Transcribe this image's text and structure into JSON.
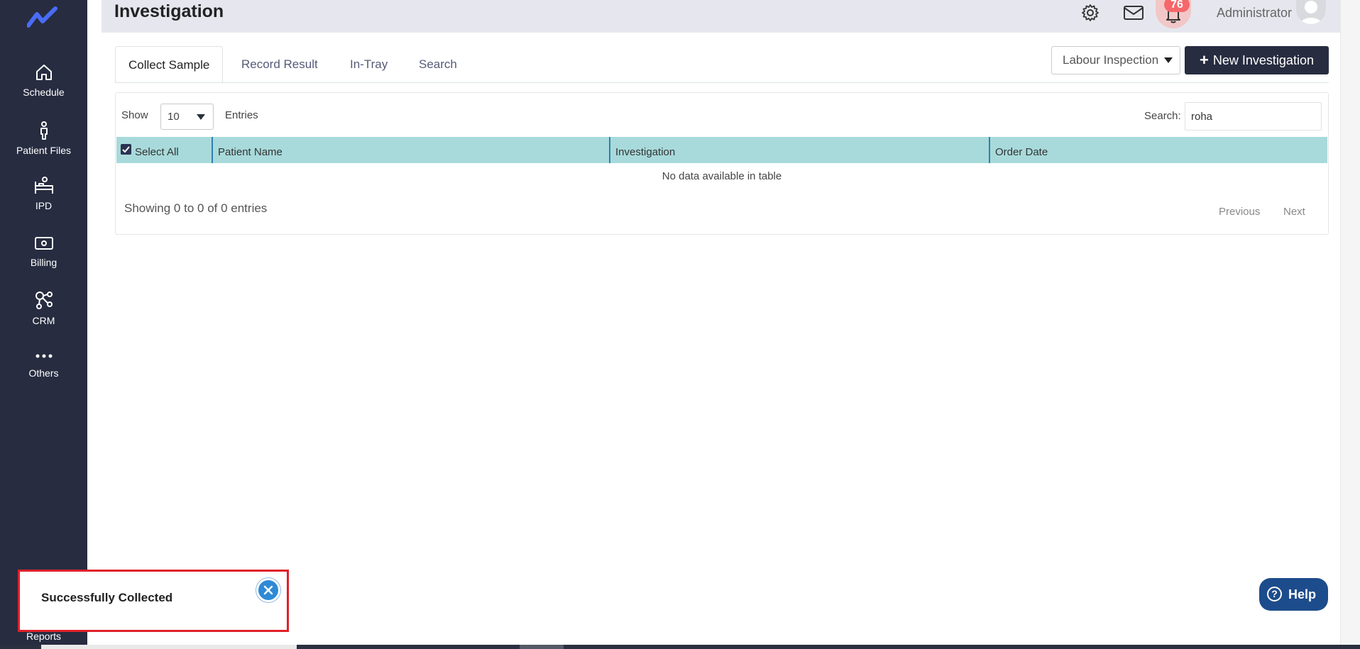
{
  "app": {
    "page_title": "Investigation",
    "admin_name": "Administrator",
    "notification_count": "76"
  },
  "sidebar": {
    "items": [
      {
        "label": "Schedule",
        "icon": "home-icon"
      },
      {
        "label": "Patient Files",
        "icon": "person-icon"
      },
      {
        "label": "IPD",
        "icon": "bed-icon"
      },
      {
        "label": "Billing",
        "icon": "money-icon"
      },
      {
        "label": "CRM",
        "icon": "crm-icon"
      },
      {
        "label": "Others",
        "icon": "more-icon"
      }
    ],
    "reports_label": "Reports"
  },
  "tabs": [
    {
      "label": "Collect Sample",
      "active": true
    },
    {
      "label": "Record Result",
      "active": false
    },
    {
      "label": "In-Tray",
      "active": false
    },
    {
      "label": "Search",
      "active": false
    }
  ],
  "toolbar": {
    "dropdown_label": "Labour Inspection",
    "new_button_label": "New Investigation"
  },
  "table": {
    "show_label": "Show",
    "page_length": "10",
    "entries_label": "Entries",
    "search_label": "Search:",
    "search_value": "roha",
    "columns": [
      "Select All",
      "Patient Name",
      "Investigation",
      "Order Date"
    ],
    "empty_message": "No data available in table",
    "info": "Showing 0 to 0 of 0 entries",
    "previous_label": "Previous",
    "next_label": "Next"
  },
  "toast": {
    "message": "Successfully Collected"
  },
  "help": {
    "label": "Help"
  },
  "colors": {
    "sidebar": "#272c40",
    "table_header": "#a8dadb",
    "primary_button": "#272c40",
    "badge": "#f5676a",
    "help_button": "#1d4c8c",
    "toast_border": "#e0202a"
  }
}
